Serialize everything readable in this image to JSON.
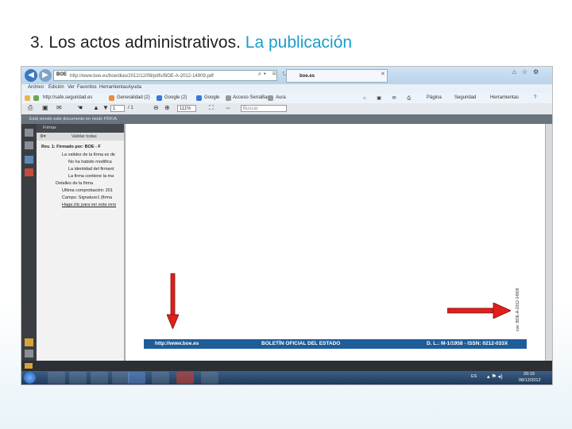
{
  "slide": {
    "title_main": "3. Los actos administrativos.",
    "title_accent": "La publicación"
  },
  "browser": {
    "url": "http://www.boe.es/boe/dias/2012/12/08/pdfs/BOE-A-2012-14909.pdf",
    "tab_label": "boe.es",
    "menu": [
      "Archivo",
      "Edición",
      "Ver",
      "Favoritos",
      "Herramientas",
      "Ayuda"
    ],
    "favorites": [
      "http://safe.seguridad.es",
      "Generalidad (2)",
      "Google (2)",
      "Google",
      "Acceso SerraBase",
      "Aura"
    ],
    "commandbar": [
      "Página",
      "Seguridad",
      "Herramientas"
    ],
    "page_current": "1",
    "page_total": "/ 1",
    "zoom": "111%",
    "search_placeholder": "Buscar"
  },
  "notice": "Está viendo este documento en modo PDF/A.",
  "signature_panel": {
    "title": "Firmas",
    "validate_all": "Validar todas",
    "lines": [
      "Rev. 1: Firmado por: BOE - F",
      "La validez de la firma es de",
      "No ha habido modifica",
      "La identidad del firmant",
      "La firma contiene la ma",
      "Detalles de la firma",
      "Última comprobación: 201",
      "Campo: Signature1 (firma",
      "Haga clic para ver esta vers"
    ]
  },
  "document": {
    "footer_url": "http://www.boe.es",
    "footer_title": "BOLETÍN OFICIAL DEL ESTADO",
    "footer_dl": "D. L.: M-1/1958 - ISSN: 0212-033X",
    "cve": "cve: BOE-A-2012-14909"
  },
  "taskbar": {
    "language": "ES",
    "time": "20:19",
    "date": "08/12/2012"
  },
  "colors": {
    "title_accent": "#1b9ec9",
    "boe_bar": "#1f5d99",
    "arrow": "#e0201a"
  }
}
